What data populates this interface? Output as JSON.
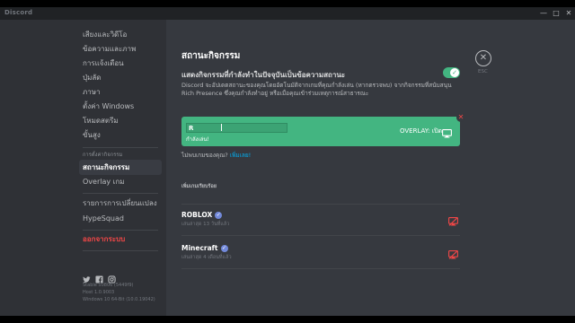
{
  "window": {
    "title": "Discord",
    "minimize": "—",
    "maximize": "□",
    "close": "✕"
  },
  "sidebar": {
    "items_top": [
      "เสียงและวิดีโอ",
      "ข้อความและภาพ",
      "การแจ้งเตือน",
      "ปุ่มลัด",
      "ภาษา",
      "ตั้งค่า Windows",
      "โหมดสตรีม",
      "ขั้นสูง"
    ],
    "game_settings_header": "การตั้งค่ากิจกรรม",
    "items_game": [
      "สถานะกิจกรรม",
      "Overlay เกม"
    ],
    "items_bottom": [
      "รายการการเปลี่ยนแปลง",
      "HypeSquad"
    ],
    "logout": "ออกจากระบบ",
    "version_lines": [
      "Stable 50806 (5449f9)",
      "Host 1.0.9003",
      "Windows 10 64-Bit (10.0.19042)"
    ]
  },
  "content": {
    "heading": "สถานะกิจกรรม",
    "display_activity_label": "แสดงกิจกรรมที่กำลังทำในปัจจุบันเป็นข้อความสถานะ",
    "display_activity_desc": "Discord จะอัปเดตสถานะของคุณโดยอัตโนมัติจากเกมที่คุณกำลังเล่น (หากตรวจพบ) จากกิจกรรมที่สนับสนุน Rich Presence ซึ่งคุณกำลังทำอยู่ หรือเมื่อคุณเข้าร่วมเหตุการณ์สาธารณะ",
    "toggle_on": true,
    "esc_label": "ESC",
    "current_game": {
      "value": "R",
      "status": "กำลังเล่น!",
      "overlay_label": "OVERLAY: เปิด"
    },
    "not_seeing_text": "ไม่พบเกมของคุณ?",
    "not_seeing_link": "เพิ่มเลย!",
    "added_games_header": "เพิ่มเกมเรียบร้อย",
    "games": [
      {
        "name": "ROBLOX",
        "last_played": "เล่นล่าสุด 13 วันที่แล้ว"
      },
      {
        "name": "Minecraft",
        "last_played": "เล่นล่าสุด 4 เดือนที่แล้ว"
      }
    ]
  },
  "colors": {
    "accent_green": "#43b581",
    "danger_red": "#f04747",
    "link_blue": "#00b0f4",
    "verified_blurple": "#7289da"
  },
  "icons": {
    "twitter": "twitter-icon",
    "facebook": "facebook-icon",
    "instagram": "instagram-icon",
    "close": "close-icon",
    "monitor": "monitor-icon",
    "overlay_disabled": "overlay-disabled-icon"
  }
}
